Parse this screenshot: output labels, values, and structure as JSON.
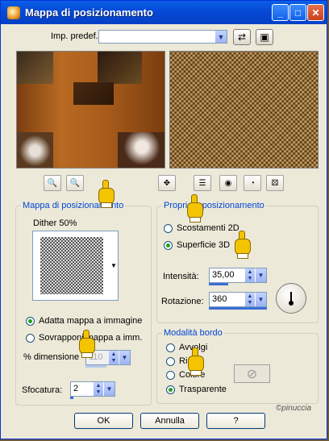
{
  "window": {
    "title": "Mappa di posizionamento",
    "min_glyph": "_",
    "max_glyph": "□",
    "close_glyph": "✕"
  },
  "preset": {
    "label": "Imp. predef.:",
    "value": ""
  },
  "displacement_map": {
    "legend": "Mappa di posizionamento",
    "dither": "Dither 50%",
    "options": [
      {
        "label": "Adatta mappa a immagine",
        "selected": true
      },
      {
        "label": "Sovrapponi mappa a imm.",
        "selected": false
      }
    ],
    "size_label": "% dimensione",
    "size_value": "110",
    "blur_label": "Sfocatura:",
    "blur_value": "2"
  },
  "displacement_props": {
    "legend": "Proprietà posizionamento",
    "options": [
      {
        "label": "Scostamenti 2D",
        "selected": false
      },
      {
        "label": "Superficie 3D",
        "selected": true
      }
    ],
    "intensity_label": "Intensità:",
    "intensity_value": "35,00",
    "rotation_label": "Rotazione:",
    "rotation_value": "360"
  },
  "edge_mode": {
    "legend": "Modalità bordo",
    "options": [
      {
        "label": "Avvolgi",
        "selected": false
      },
      {
        "label": "Ripeti",
        "selected": false
      },
      {
        "label": "Colore",
        "selected": false
      },
      {
        "label": "Trasparente",
        "selected": true
      }
    ]
  },
  "buttons": {
    "ok": "OK",
    "cancel": "Annulla",
    "help": "?"
  },
  "watermark": "©pinuccia"
}
